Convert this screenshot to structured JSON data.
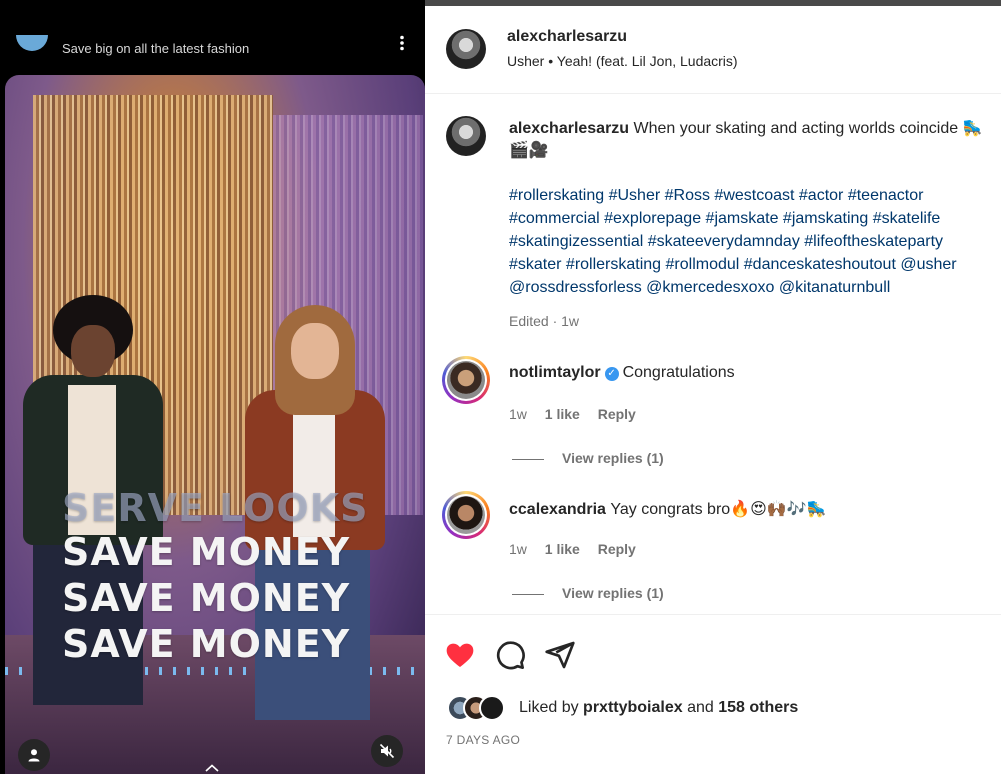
{
  "ad": {
    "text": "Save big on all the latest fashion",
    "more_icon": "⋮"
  },
  "video": {
    "overlay_lines": [
      "SERVE LOOKS",
      "SAVE MONEY",
      "SAVE MONEY",
      "SAVE MONEY"
    ]
  },
  "post": {
    "username": "alexcharlesarzu",
    "audio": "Usher • Yeah! (feat. Lil Jon, Ludacris)"
  },
  "caption": {
    "username": "alexcharlesarzu",
    "text": "When your skating and acting worlds coincide 🛼",
    "line2": "🎬🎥",
    "tag_lines": [
      "#rollerskating #Usher #Ross #westcoast #actor #teenactor",
      "#commercial #explorepage #jamskate #jamskating #skatelife",
      "#skatingizessential #skateeverydamnday #lifeoftheskateparty",
      "#skater #rollerskating #rollmodul #danceskateshoutout @usher",
      "@rossdressforless @kmercedesxoxo @kitanaturnbull"
    ],
    "edited": "Edited · 1w"
  },
  "comments": [
    {
      "username": "notlimtaylor",
      "verified": true,
      "text": "Congratulations",
      "age": "1w",
      "likes": "1 like",
      "reply": "Reply",
      "view_replies": "View replies (1)"
    },
    {
      "username": "ccalexandria",
      "verified": false,
      "text": "Yay congrats bro🔥😍🙌🏾🎶🛼",
      "age": "1w",
      "likes": "1 like",
      "reply": "Reply",
      "view_replies": "View replies (1)"
    }
  ],
  "likes": {
    "prefix": "Liked by",
    "user": "prxttyboialex",
    "joiner": "and",
    "others": "158 others"
  },
  "date": "7 DAYS AGO",
  "colors": {
    "like_heart": "#ff3040",
    "link": "#00376b",
    "muted": "#737373",
    "verified": "#3897f0"
  },
  "icons": [
    "more-icon",
    "user-icon",
    "mute-icon",
    "heart-icon",
    "comment-icon",
    "share-icon",
    "verified-icon"
  ]
}
